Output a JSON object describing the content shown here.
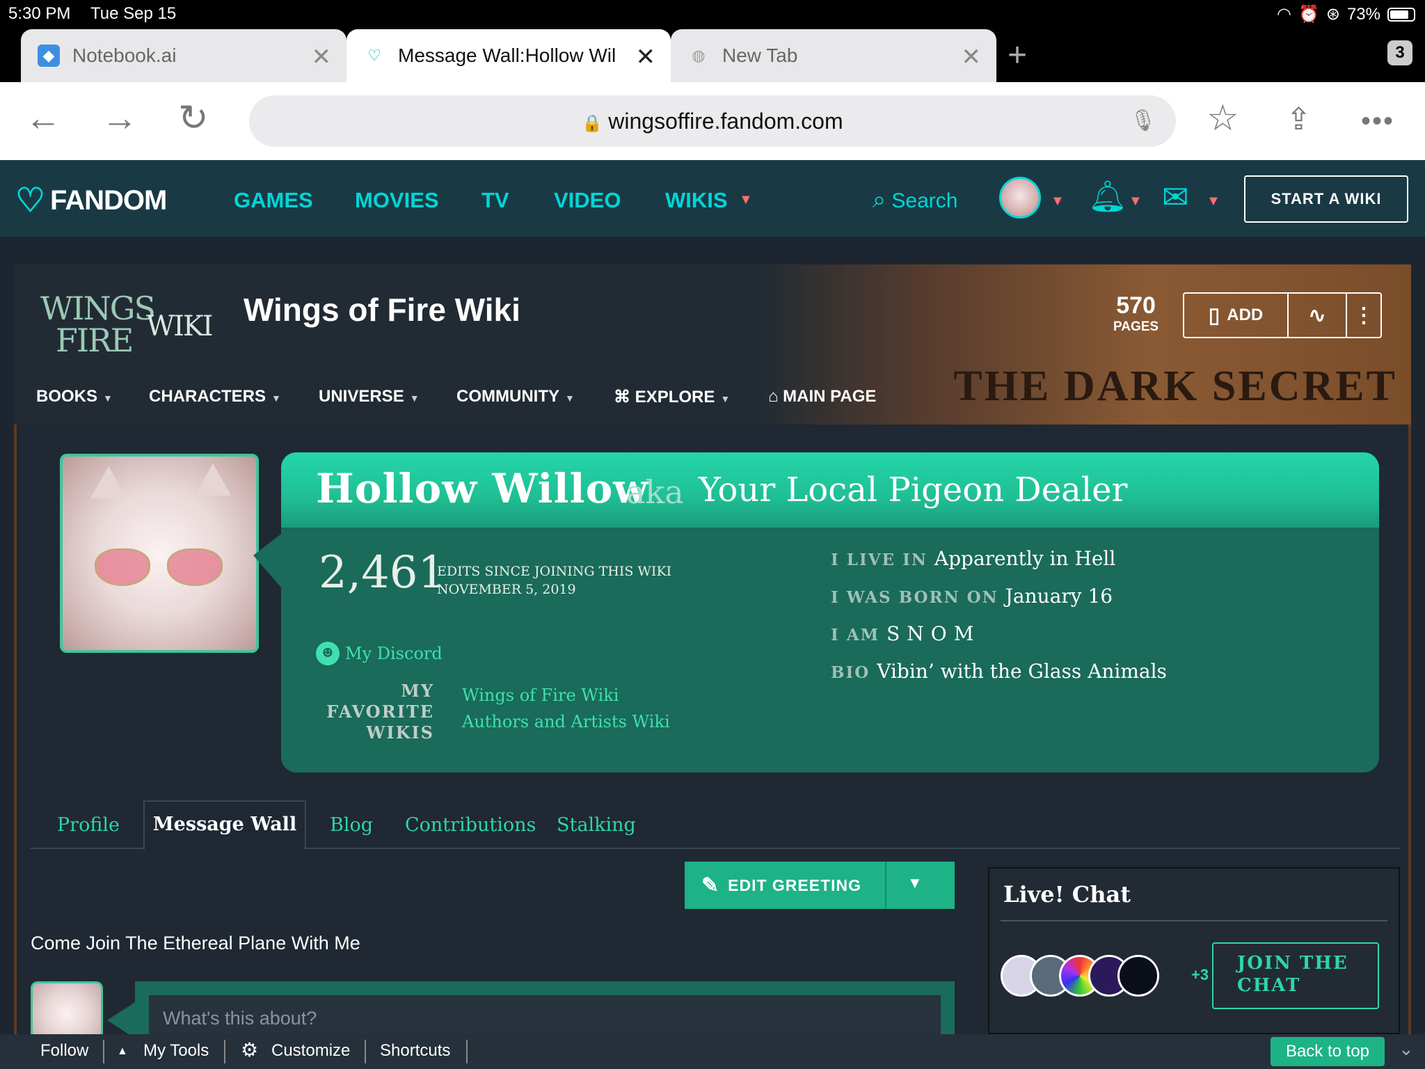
{
  "status": {
    "time": "5:30 PM",
    "date": "Tue Sep 15",
    "battery": "73%"
  },
  "browser_tabs": [
    {
      "label": "Notebook.ai",
      "active": false
    },
    {
      "label": "Message Wall:Hollow Wil",
      "active": true
    },
    {
      "label": "New Tab",
      "active": false
    }
  ],
  "tab_count": "3",
  "url": "wingsoffire.fandom.com",
  "fandom": {
    "logo": "FANDOM",
    "nav": [
      "GAMES",
      "MOVIES",
      "TV",
      "VIDEO",
      "WIKIS"
    ],
    "search": "Search",
    "start_wiki": "START A WIKI"
  },
  "wiki": {
    "logo_line1": "WINGS",
    "logo_line2": "FIRE",
    "logo_wiki": "WIKI",
    "title": "Wings of Fire Wiki",
    "pages_count": "570",
    "pages_label": "PAGES",
    "add_label": "ADD",
    "banner_text": "THE DARK SECRET",
    "nav": [
      "BOOKS",
      "CHARACTERS",
      "UNIVERSE",
      "COMMUNITY",
      "EXPLORE",
      "MAIN PAGE"
    ]
  },
  "profile": {
    "username": "Hollow Willow",
    "aka": "aka",
    "nickname": "Your Local Pigeon Dealer",
    "edit_count": "2,461",
    "edits_label": "EDITS SINCE JOINING THIS WIKI",
    "join_date": "NOVEMBER 5, 2019",
    "discord": "My Discord",
    "fav_label": "MY FAVORITE WIKIS",
    "fav_label_1": "MY",
    "fav_label_2": "FAVORITE",
    "fav_label_3": "WIKIS",
    "favorite_wikis": [
      "Wings of Fire Wiki",
      "Authors and Artists Wiki"
    ],
    "facts": [
      {
        "label": "I LIVE IN",
        "value": "Apparently in Hell"
      },
      {
        "label": "I WAS BORN ON",
        "value": "January 16"
      },
      {
        "label": "I AM",
        "value": "SNOM"
      },
      {
        "label": "BIO",
        "value": "Vibin’ with the Glass Animals"
      }
    ]
  },
  "profile_tabs": [
    "Profile",
    "Message Wall",
    "Blog",
    "Contributions",
    "Stalking"
  ],
  "edit_greeting": "EDIT GREETING",
  "greeting_text": "Come Join The Ethereal Plane With Me",
  "composer_placeholder": "What's this about?",
  "chat": {
    "title": "Live! Chat",
    "more_users": "+3",
    "join": "JOIN THE CHAT",
    "join_1": "JOIN THE",
    "join_2": "CHAT"
  },
  "bottom": {
    "follow": "Follow",
    "my_tools": "My Tools",
    "customize": "Customize",
    "shortcuts": "Shortcuts",
    "back_to_top": "Back to top"
  },
  "colors": {
    "fandom_bar": "#193a45",
    "accent": "#00d6d6",
    "card": "#1a6b59",
    "button_green": "#1db386"
  }
}
